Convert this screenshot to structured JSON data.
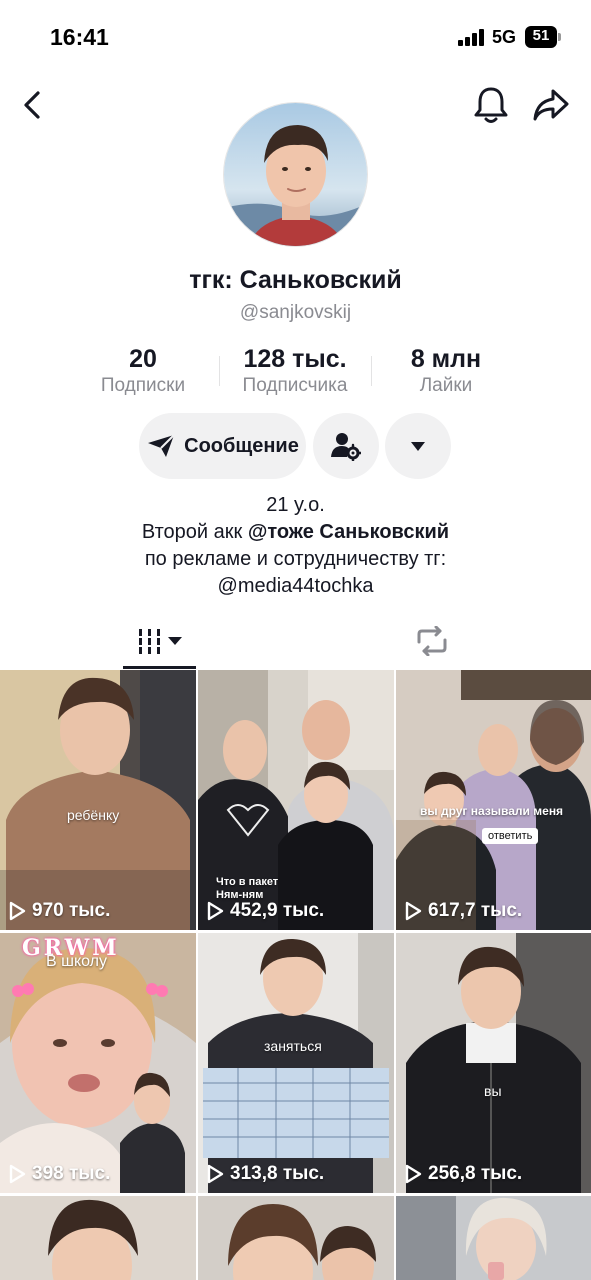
{
  "status_bar": {
    "time": "16:41",
    "network": "5G",
    "battery": "51"
  },
  "nav": {
    "back_icon": "chevron-left-icon",
    "bell_icon": "bell-icon",
    "share_icon": "share-arrow-icon"
  },
  "profile": {
    "display_name": "тгк: Саньковский",
    "username": "@sanjkovskij"
  },
  "stats": [
    {
      "value": "20",
      "label": "Подписки"
    },
    {
      "value": "128 тыс.",
      "label": "Подписчика"
    },
    {
      "value": "8 млн",
      "label": "Лайки"
    }
  ],
  "actions": {
    "message_label": "Сообщение"
  },
  "bio": {
    "line1": "21 y.o.",
    "line2_prefix": "Второй акк ",
    "line2_mention": "@тоже Саньковский",
    "line3": "по рекламе и сотрудничеству тг:",
    "line4": "@media44tochka"
  },
  "tabs": {
    "videos_icon": "grid-icon",
    "reposts_icon": "repost-icon"
  },
  "videos": [
    {
      "views": "970 тыс.",
      "caption": "ребёнку"
    },
    {
      "views": "452,9 тыс.",
      "caption": "Что в пакет Ням-ням"
    },
    {
      "views": "617,7 тыс.",
      "caption": "вы друг называли меня"
    },
    {
      "views": "398 тыс.",
      "caption": "В школу",
      "title_art": "GRWM"
    },
    {
      "views": "313,8 тыс.",
      "caption": "заняться"
    },
    {
      "views": "256,8 тыс.",
      "caption": "вы"
    },
    {
      "views": ""
    },
    {
      "views": ""
    },
    {
      "views": ""
    }
  ],
  "colors": {
    "text": "#161823",
    "secondary": "#8a8b91",
    "button_bg": "#f1f1f2"
  }
}
